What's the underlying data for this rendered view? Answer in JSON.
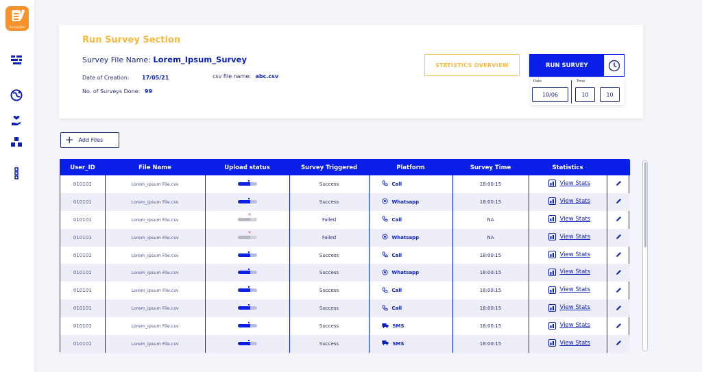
{
  "sidebar": {
    "logo_text": "SurveyBot",
    "items": [
      {
        "icon": "layers-icon"
      },
      {
        "icon": "globe-icon"
      },
      {
        "icon": "hand-heart-icon"
      },
      {
        "icon": "cubes-icon"
      },
      {
        "icon": "dots-vertical-icon"
      }
    ]
  },
  "survey": {
    "section_title": "Run Survey Section",
    "file_name_label": "Survey File Name:",
    "file_name": "Lorem_Ipsum_Survey",
    "date_label": "Date of Creation:",
    "date_value": "17/05/21",
    "csv_label": "csv file name:",
    "csv_value": "abc.csv",
    "surveys_label": "No. of Surveys Done:",
    "surveys_value": "99",
    "stats_button": "STATISTICS OVERVIEW",
    "run_button": "RUN SURVEY",
    "schedule": {
      "date_label": "Date",
      "date_value": "10/06",
      "time_label": "Time",
      "hour_value": "10",
      "minute_value": "10"
    }
  },
  "add_files_label": "Add Files",
  "table": {
    "headers": [
      "User_ID",
      "File Name",
      "Upload status",
      "Survey Triggered",
      "Platform",
      "Survey Time",
      "Statistics"
    ],
    "view_stats_label": "View Stats",
    "rows": [
      {
        "user_id": "010101",
        "file": "Lorem_ipsum File.csv",
        "upload": 1,
        "status": "Success",
        "platform": "Call",
        "time": "18:00:15"
      },
      {
        "user_id": "010101",
        "file": "Lorem_ipsum File.csv",
        "upload": 1,
        "status": "Success",
        "platform": "Whatsapp",
        "time": "18:00:15"
      },
      {
        "user_id": "010101",
        "file": "Lorem_ipsum File.csv",
        "upload": 0,
        "status": "Failed",
        "platform": "Call",
        "time": "NA"
      },
      {
        "user_id": "010101",
        "file": "Lorem_ipsum File.csv",
        "upload": 0,
        "status": "Failed",
        "platform": "Whatsapp",
        "time": "NA"
      },
      {
        "user_id": "010101",
        "file": "Lorem_ipsum File.csv",
        "upload": 1,
        "status": "Success",
        "platform": "Call",
        "time": "18:00:15"
      },
      {
        "user_id": "010101",
        "file": "Lorem_ipsum File.csv",
        "upload": 1,
        "status": "Success",
        "platform": "Whatsapp",
        "time": "18:00:15"
      },
      {
        "user_id": "010101",
        "file": "Lorem_ipsum File.csv",
        "upload": 1,
        "status": "Success",
        "platform": "Call",
        "time": "18:00:15"
      },
      {
        "user_id": "010101",
        "file": "Lorem_ipsum File.csv",
        "upload": 1,
        "status": "Success",
        "platform": "Call",
        "time": "18:00:15"
      },
      {
        "user_id": "010101",
        "file": "Lorem_ipsum File.csv",
        "upload": 1,
        "status": "Success",
        "platform": "SMS",
        "time": "18:00:15"
      },
      {
        "user_id": "010101",
        "file": "Lorem_ipsum File.csv",
        "upload": 1,
        "status": "Success",
        "platform": "SMS",
        "time": "18:00:15"
      }
    ]
  },
  "colors": {
    "primary": "#0a1fe8",
    "accent": "#f7b93c",
    "logo": "#f7922c",
    "failed": "#e23a3a"
  }
}
